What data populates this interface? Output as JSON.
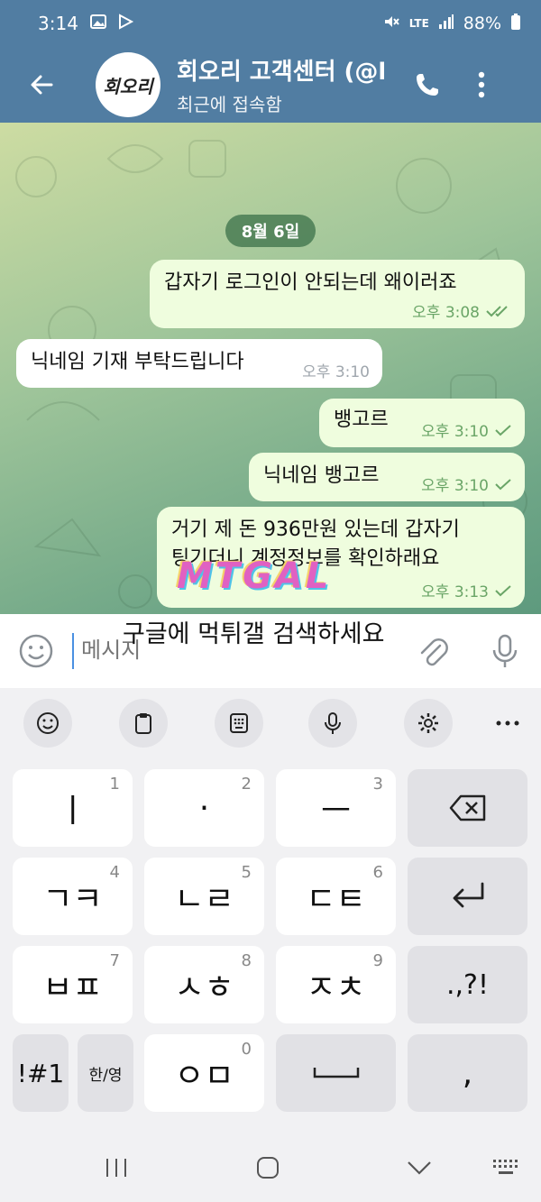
{
  "status": {
    "time": "3:14",
    "battery": "88%",
    "network": "LTE"
  },
  "header": {
    "avatar_text": "회오리",
    "title": "회오리 고객센터 (@l",
    "subtitle": "최근에 접속함"
  },
  "chat": {
    "date": "8월 6일",
    "messages": [
      {
        "dir": "out",
        "text": "갑자기 로그인이 안되는데 왜이러죠",
        "time": "오후 3:08",
        "status": "read"
      },
      {
        "dir": "in",
        "text": "닉네임 기재 부탁드립니다",
        "time": "오후 3:10"
      },
      {
        "dir": "out",
        "text": "뱅고르",
        "time": "오후 3:10",
        "status": "sent"
      },
      {
        "dir": "out",
        "text": "닉네임 뱅고르",
        "time": "오후 3:10",
        "status": "sent"
      },
      {
        "dir": "out",
        "text": "거기 제 돈 936만원 있는데 갑자기",
        "text2": "팅기더니 계정정보를 확인하래요",
        "time": "오후 3:13",
        "status": "sent"
      }
    ],
    "watermark": "MTGAL"
  },
  "composer": {
    "placeholder": "메시지",
    "overlay_text": "구글에 먹튀갤 검색하세요"
  },
  "keyboard": {
    "toolbar": [
      "emoji",
      "clipboard",
      "keypad",
      "mic",
      "settings",
      "more"
    ],
    "rows": [
      [
        {
          "label": "ㅣ",
          "num": "1"
        },
        {
          "label": "·",
          "num": "2"
        },
        {
          "label": "ㅡ",
          "num": "3"
        },
        {
          "label": "⌫",
          "num": "",
          "gray": true
        }
      ],
      [
        {
          "label": "ㄱㅋ",
          "num": "4"
        },
        {
          "label": "ㄴㄹ",
          "num": "5"
        },
        {
          "label": "ㄷㅌ",
          "num": "6"
        },
        {
          "label": "↵",
          "num": "",
          "gray": true
        }
      ],
      [
        {
          "label": "ㅂㅍ",
          "num": "7"
        },
        {
          "label": "ㅅㅎ",
          "num": "8"
        },
        {
          "label": "ㅈㅊ",
          "num": "9"
        },
        {
          "label": ".,?!",
          "num": "",
          "gray": true
        }
      ],
      [
        {
          "label": "!#1",
          "num": "",
          "gray": true
        },
        {
          "label": "한/영",
          "num": "",
          "gray": true
        },
        {
          "label": "ㅇㅁ",
          "num": "0"
        },
        {
          "label": "␣",
          "num": "",
          "gray": true
        },
        {
          "label": ",",
          "num": "",
          "gray": true
        }
      ]
    ]
  },
  "colors": {
    "header": "#517da2",
    "outgoing_bubble": "#effdde",
    "incoming_bubble": "#ffffff",
    "check": "#6aa567"
  }
}
